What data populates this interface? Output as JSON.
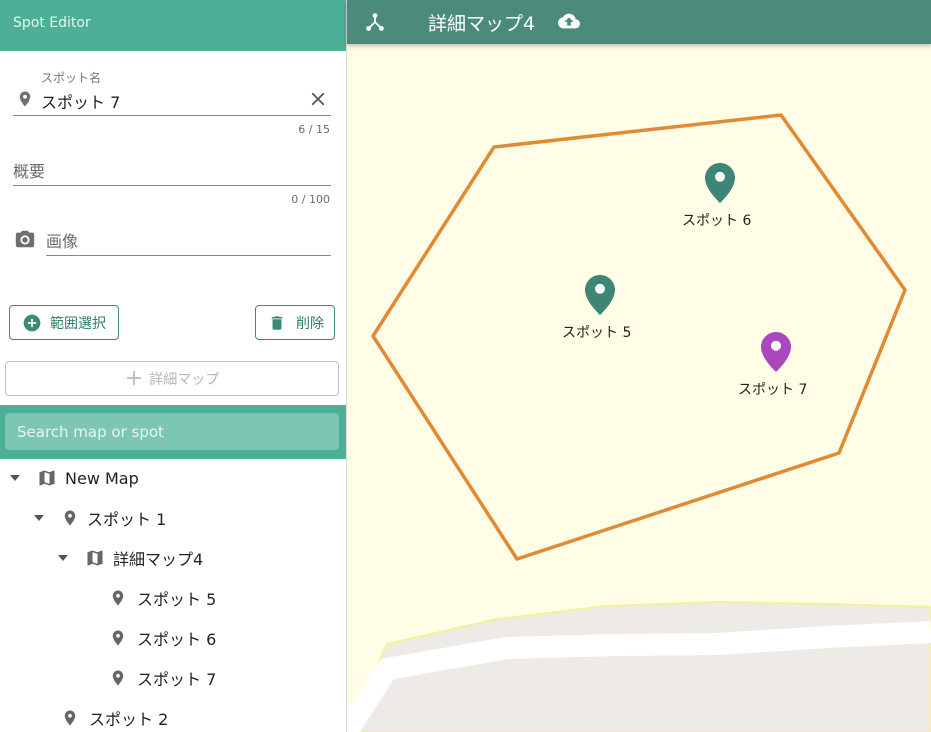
{
  "sidebar": {
    "title": "Spot Editor",
    "spot_name": {
      "label": "スポット名",
      "value": "スポット 7",
      "counter": "6 / 15"
    },
    "summary": {
      "placeholder": "概要",
      "counter": "0 / 100"
    },
    "image": {
      "placeholder": "画像"
    },
    "range_select_label": "範囲選択",
    "delete_label": "削除",
    "detail_map_label": "詳細マップ",
    "search_placeholder": "Search map or spot",
    "tree": [
      {
        "label": "New Map",
        "type": "map",
        "expanded": true
      },
      {
        "label": "スポット 1",
        "type": "spot",
        "expanded": true
      },
      {
        "label": "詳細マップ4",
        "type": "map",
        "expanded": true
      },
      {
        "label": "スポット 5",
        "type": "spot"
      },
      {
        "label": "スポット 6",
        "type": "spot"
      },
      {
        "label": "スポット 7",
        "type": "spot"
      },
      {
        "label": "スポット 2",
        "type": "spot"
      }
    ]
  },
  "map": {
    "title": "詳細マップ4",
    "spots": [
      {
        "label": "スポット 6",
        "color": "#3d8575",
        "selected": false
      },
      {
        "label": "スポット 5",
        "color": "#3d8575",
        "selected": false
      },
      {
        "label": "スポット 7",
        "color": "#ab47bc",
        "selected": true
      }
    ],
    "polygon_color": "#e08a36"
  },
  "colors": {
    "header_green": "#4caf96",
    "topbar_green": "#4c8b7b",
    "map_background": "#fffde6"
  }
}
